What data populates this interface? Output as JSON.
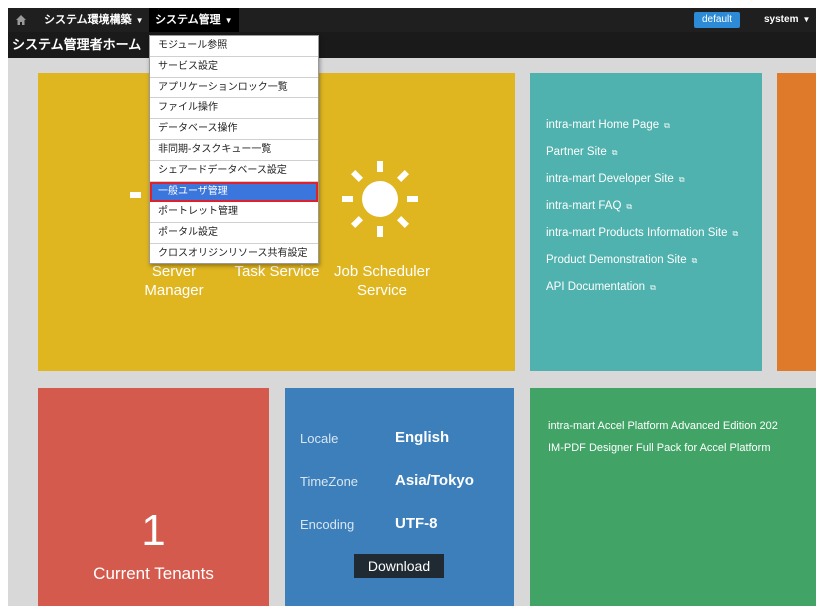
{
  "topbar": {
    "home_icon": "home-icon",
    "menus": [
      {
        "label": "システム環境構築"
      },
      {
        "label": "システム管理"
      }
    ],
    "caret": "▼",
    "theme": "default",
    "user": "system"
  },
  "page": {
    "title": "システム管理者ホーム"
  },
  "dropdown": {
    "items": [
      {
        "label": "モジュール参照"
      },
      {
        "label": "サービス設定"
      },
      {
        "label": "アプリケーションロック一覧"
      },
      {
        "label": "ファイル操作"
      },
      {
        "label": "データベース操作"
      },
      {
        "label": "非同期-タスクキュー一覧"
      },
      {
        "label": "シェアードデータベース設定"
      },
      {
        "label": "一般ユーザ管理"
      },
      {
        "label": "ポートレット管理"
      },
      {
        "label": "ポータル設定"
      },
      {
        "label": "クロスオリジンリソース共有設定"
      }
    ],
    "highlighted_index": 7
  },
  "services": {
    "server_manager": "Server\nManager",
    "task_service": "Task Service",
    "job_scheduler": "Job Scheduler\nService"
  },
  "links": [
    {
      "label": "intra-mart Home Page"
    },
    {
      "label": "Partner Site"
    },
    {
      "label": "intra-mart Developer Site"
    },
    {
      "label": "intra-mart FAQ"
    },
    {
      "label": "intra-mart Products Information Site"
    },
    {
      "label": "Product Demonstration Site"
    },
    {
      "label": "API Documentation"
    }
  ],
  "tenants": {
    "count": "1",
    "label": "Current Tenants"
  },
  "environment": {
    "locale_label": "Locale",
    "locale_value": "English",
    "timezone_label": "TimeZone",
    "timezone_value": "Asia/Tokyo",
    "encoding_label": "Encoding",
    "encoding_value": "UTF-8",
    "download_label": "Download"
  },
  "licenses": [
    {
      "label": "intra-mart Accel Platform Advanced Edition 202"
    },
    {
      "label": "IM-PDF Designer Full Pack for Accel Platform"
    }
  ],
  "colors": {
    "yellow_tile": "#dfb520",
    "teal_tile": "#4fb2ae",
    "orange_tile": "#de7a2a",
    "red_tile": "#d45a4d",
    "blue_tile": "#3c7fbb",
    "green_tile": "#41a466",
    "highlight": "#3b76dc",
    "highlight_border": "#e0202a"
  }
}
